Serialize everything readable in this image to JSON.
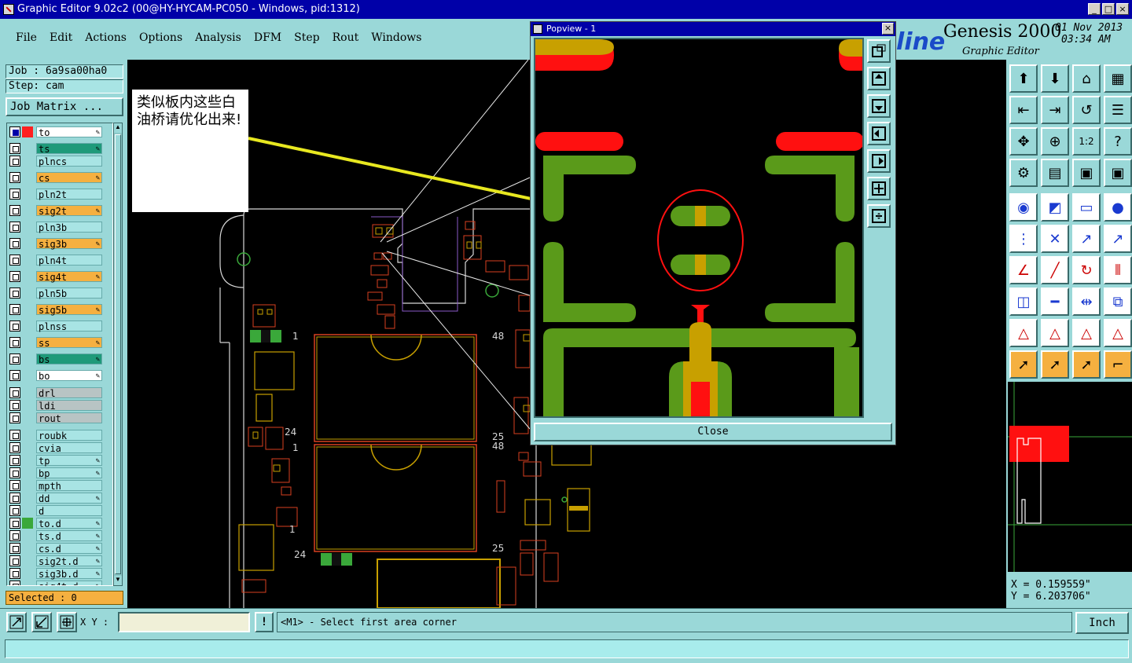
{
  "window": {
    "title": "Graphic Editor 9.02c2 (00@HY-HYCAM-PC050 - Windows, pid:1312)",
    "minimize": "_",
    "maximize": "□",
    "close": "×"
  },
  "menu": [
    "File",
    "Edit",
    "Actions",
    "Options",
    "Analysis",
    "DFM",
    "Step",
    "Rout",
    "Windows"
  ],
  "branding": {
    "logo_text": "line",
    "product": "Genesis 2000",
    "subtitle": "Graphic Editor",
    "date": "01 Nov 2013",
    "time": "03:34 AM"
  },
  "left_panel": {
    "job": "Job : 6a9sa00ha0",
    "step": "Step: cam",
    "job_matrix_button": "Job Matrix ...",
    "selected": "Selected : 0",
    "layers": [
      {
        "name": "to",
        "style": "white",
        "swatch": "#ff2020",
        "checked": true,
        "pen": true
      },
      {
        "name": "ts",
        "style": "green",
        "swatch": "",
        "checked": false,
        "pen": true
      },
      {
        "name": "plncs",
        "style": "",
        "swatch": "",
        "checked": false,
        "pen": false
      },
      {
        "name": "cs",
        "style": "orange",
        "swatch": "",
        "checked": false,
        "pen": true
      },
      {
        "name": "pln2t",
        "style": "",
        "swatch": "",
        "checked": false,
        "pen": false
      },
      {
        "name": "sig2t",
        "style": "orange",
        "swatch": "",
        "checked": false,
        "pen": true
      },
      {
        "name": "pln3b",
        "style": "",
        "swatch": "",
        "checked": false,
        "pen": false
      },
      {
        "name": "sig3b",
        "style": "orange",
        "swatch": "",
        "checked": false,
        "pen": true
      },
      {
        "name": "pln4t",
        "style": "",
        "swatch": "",
        "checked": false,
        "pen": false
      },
      {
        "name": "sig4t",
        "style": "orange",
        "swatch": "",
        "checked": false,
        "pen": true
      },
      {
        "name": "pln5b",
        "style": "",
        "swatch": "",
        "checked": false,
        "pen": false
      },
      {
        "name": "sig5b",
        "style": "orange",
        "swatch": "",
        "checked": false,
        "pen": true
      },
      {
        "name": "plnss",
        "style": "",
        "swatch": "",
        "checked": false,
        "pen": false
      },
      {
        "name": "ss",
        "style": "orange",
        "swatch": "",
        "checked": false,
        "pen": true
      },
      {
        "name": "bs",
        "style": "green",
        "swatch": "",
        "checked": false,
        "pen": true
      },
      {
        "name": "bo",
        "style": "white",
        "swatch": "",
        "checked": false,
        "pen": true
      },
      {
        "name": "drl",
        "style": "gray",
        "swatch": "",
        "checked": false,
        "pen": false
      },
      {
        "name": "ldi",
        "style": "gray",
        "swatch": "",
        "checked": false,
        "pen": false
      },
      {
        "name": "rout",
        "style": "gray",
        "swatch": "",
        "checked": false,
        "pen": false
      },
      {
        "name": "roubk",
        "style": "",
        "swatch": "",
        "checked": false,
        "pen": false
      },
      {
        "name": "cvia",
        "style": "",
        "swatch": "",
        "checked": false,
        "pen": false
      },
      {
        "name": "tp",
        "style": "",
        "swatch": "",
        "checked": false,
        "pen": true
      },
      {
        "name": "bp",
        "style": "",
        "swatch": "",
        "checked": false,
        "pen": true
      },
      {
        "name": "mpth",
        "style": "",
        "swatch": "",
        "checked": false,
        "pen": false
      },
      {
        "name": "dd",
        "style": "",
        "swatch": "",
        "checked": false,
        "pen": true
      },
      {
        "name": "d",
        "style": "",
        "swatch": "",
        "checked": false,
        "pen": false
      },
      {
        "name": "to.d",
        "style": "",
        "swatch": "#3aa83a",
        "checked": false,
        "pen": true
      },
      {
        "name": "ts.d",
        "style": "",
        "swatch": "",
        "checked": false,
        "pen": true
      },
      {
        "name": "cs.d",
        "style": "",
        "swatch": "",
        "checked": false,
        "pen": true
      },
      {
        "name": "sig2t.d",
        "style": "",
        "swatch": "",
        "checked": false,
        "pen": true
      },
      {
        "name": "sig3b.d",
        "style": "",
        "swatch": "",
        "checked": false,
        "pen": true
      },
      {
        "name": "sig4t.d",
        "style": "",
        "swatch": "",
        "checked": false,
        "pen": true
      }
    ]
  },
  "annotation": {
    "text": "类似板内这些白油桥请优化出来!"
  },
  "canvas_labels": [
    "1",
    "48",
    "24",
    "1",
    "25",
    "48",
    "1",
    "24",
    "25"
  ],
  "popview": {
    "title": "Popview - 1",
    "close_x": "×",
    "close_button": "Close"
  },
  "coords": {
    "x": "X = 0.159559\"",
    "y": "Y = 6.203706\""
  },
  "bottom": {
    "xy_label": "X Y :",
    "xy_value": "",
    "excl": "!",
    "prompt": "<M1> - Select first area corner",
    "units": "Inch"
  },
  "colors": {
    "background": "#9ad8d8",
    "title_bar": "#0000a8",
    "canvas": "#000000",
    "copper": "#5a9a1a",
    "pad_gold": "#c8a000",
    "mask_red": "#ff1010",
    "annotation_line": "#e8e820"
  }
}
